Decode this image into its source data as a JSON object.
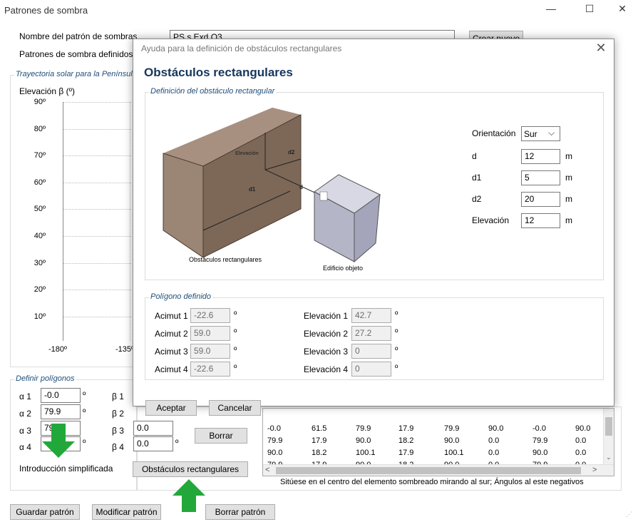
{
  "window": {
    "title": "Patrones de sombra",
    "minimize": "—",
    "maximize": "☐",
    "close": "✕"
  },
  "main": {
    "pattern_name_label": "Nombre del patrón de sombras",
    "pattern_name_value": "PS s Exd O3",
    "defined_patterns_label": "Patrones de sombra definidos",
    "create_new": "Crear nuevo"
  },
  "chart": {
    "group_title": "Trayectoria solar para la Península",
    "y_axis_label": "Elevación β (º)"
  },
  "chart_data": {
    "type": "line",
    "title": "Trayectoria solar para la Península",
    "ylabel": "Elevación β (º)",
    "ylim": [
      0,
      90
    ],
    "y_ticks": [
      "90º",
      "80º",
      "70º",
      "60º",
      "50º",
      "40º",
      "30º",
      "20º",
      "10º"
    ],
    "x_ticks": [
      "-180º",
      "-135º"
    ],
    "series": []
  },
  "polygons": {
    "group_title": "Definir polígonos",
    "alpha_labels": [
      "α 1",
      "α 2",
      "α 3",
      "α 4"
    ],
    "alpha_values": [
      "-0.0",
      "79.9",
      "79.9",
      ""
    ],
    "beta_labels": [
      "β 1",
      "β 2",
      "β 3",
      "β 4"
    ],
    "beta_values": [
      "",
      "",
      "0.0",
      "0.0"
    ],
    "degree": "º",
    "delete": "Borrar",
    "simplified_label": "Introducción simplificada",
    "rect_obstacles_button": "Obstáculos rectangulares"
  },
  "table": {
    "rows": [
      [
        "-0.0",
        "61.5",
        "79.9",
        "17.9",
        "79.9",
        "90.0",
        "-0.0",
        "90.0"
      ],
      [
        "79.9",
        "17.9",
        "90.0",
        "18.2",
        "90.0",
        "0.0",
        "79.9",
        "0.0"
      ],
      [
        "90.0",
        "18.2",
        "100.1",
        "17.9",
        "100.1",
        "0.0",
        "90.0",
        "0.0"
      ],
      [
        "79.9",
        "17.9",
        "90.0",
        "18.2",
        "90.0",
        "0.0",
        "79.9",
        "0.0"
      ]
    ],
    "hint": "Sitúese en el centro del elemento sombreado mirando al sur; Ángulos al este negativos"
  },
  "footer": {
    "save": "Guardar patrón",
    "modify": "Modificar patrón",
    "delete": "Borrar patrón"
  },
  "dialog": {
    "title": "Ayuda para la definición de obstáculos rectangulares",
    "close": "✕",
    "heading": "Obstáculos rectangulares",
    "definition_group": "Definición del obstáculo rectangular",
    "orientation_label": "Orientación",
    "orientation_value": "Sur",
    "fields": [
      {
        "label": "d",
        "value": "12",
        "unit": "m"
      },
      {
        "label": "d1",
        "value": "5",
        "unit": "m"
      },
      {
        "label": "d2",
        "value": "20",
        "unit": "m"
      },
      {
        "label": "Elevación",
        "value": "12",
        "unit": "m"
      }
    ],
    "diagram": {
      "elevation": "Elevación",
      "d": "d",
      "d1": "d1",
      "d2": "d2",
      "caption_obstacles": "Obstáculos rectangulares",
      "caption_building": "Edificio objeto"
    },
    "polygon_group": "Polígono definido",
    "azimuth_labels": [
      "Acimut 1",
      "Acimut 2",
      "Acimut 3",
      "Acimut 4"
    ],
    "azimuth_values": [
      "-22.6",
      "59.0",
      "59.0",
      "-22.6"
    ],
    "elev_labels": [
      "Elevación 1",
      "Elevación 2",
      "Elevación 3",
      "Elevación 4"
    ],
    "elev_values": [
      "42.7",
      "27.2",
      "0",
      "0"
    ],
    "degree": "º",
    "accept": "Aceptar",
    "cancel": "Cancelar"
  },
  "colors": {
    "accent_arrow": "#22a83a",
    "heading": "#17365d"
  }
}
